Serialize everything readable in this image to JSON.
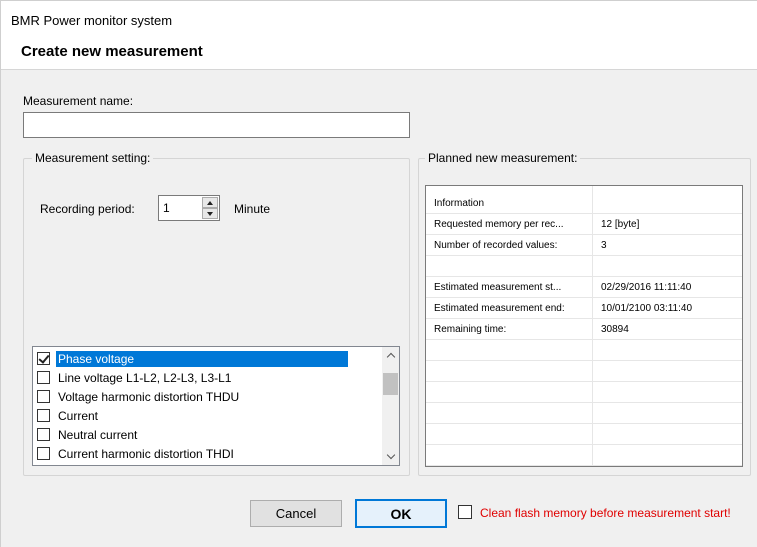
{
  "window": {
    "title": "BMR Power monitor system",
    "header": "Create new measurement"
  },
  "name_field": {
    "label": "Measurement name:",
    "value": ""
  },
  "measurement_setting": {
    "group_title": "Measurement setting:",
    "recording_period_label": "Recording period:",
    "recording_period_value": "1",
    "recording_period_unit": "Minute",
    "items": [
      {
        "label": "Phase voltage",
        "checked": true,
        "selected": true
      },
      {
        "label": "Line voltage L1-L2, L2-L3, L3-L1",
        "checked": false,
        "selected": false
      },
      {
        "label": "Voltage harmonic distortion THDU",
        "checked": false,
        "selected": false
      },
      {
        "label": "Current",
        "checked": false,
        "selected": false
      },
      {
        "label": "Neutral current",
        "checked": false,
        "selected": false
      },
      {
        "label": "Current harmonic distortion THDI",
        "checked": false,
        "selected": false
      }
    ]
  },
  "planned": {
    "group_title": "Planned new measurement:",
    "rows": [
      {
        "label": "Information",
        "value": ""
      },
      {
        "label": "Requested memory per rec...",
        "value": "12 [byte]"
      },
      {
        "label": "Number of recorded values:",
        "value": "3"
      },
      {
        "label": "",
        "value": ""
      },
      {
        "label": "Estimated measurement st...",
        "value": "02/29/2016 11:11:40"
      },
      {
        "label": "Estimated measurement end:",
        "value": "10/01/2100 03:11:40"
      },
      {
        "label": "Remaining time:",
        "value": "30894"
      },
      {
        "label": "",
        "value": ""
      },
      {
        "label": "",
        "value": ""
      },
      {
        "label": "",
        "value": ""
      },
      {
        "label": "",
        "value": ""
      },
      {
        "label": "",
        "value": ""
      },
      {
        "label": "",
        "value": ""
      }
    ]
  },
  "footer": {
    "cancel_label": "Cancel",
    "ok_label": "OK",
    "flash_label": "Clean flash memory before measurement start!",
    "flash_checked": false
  },
  "colors": {
    "selection": "#0078d7",
    "warning_text": "#e00000"
  }
}
